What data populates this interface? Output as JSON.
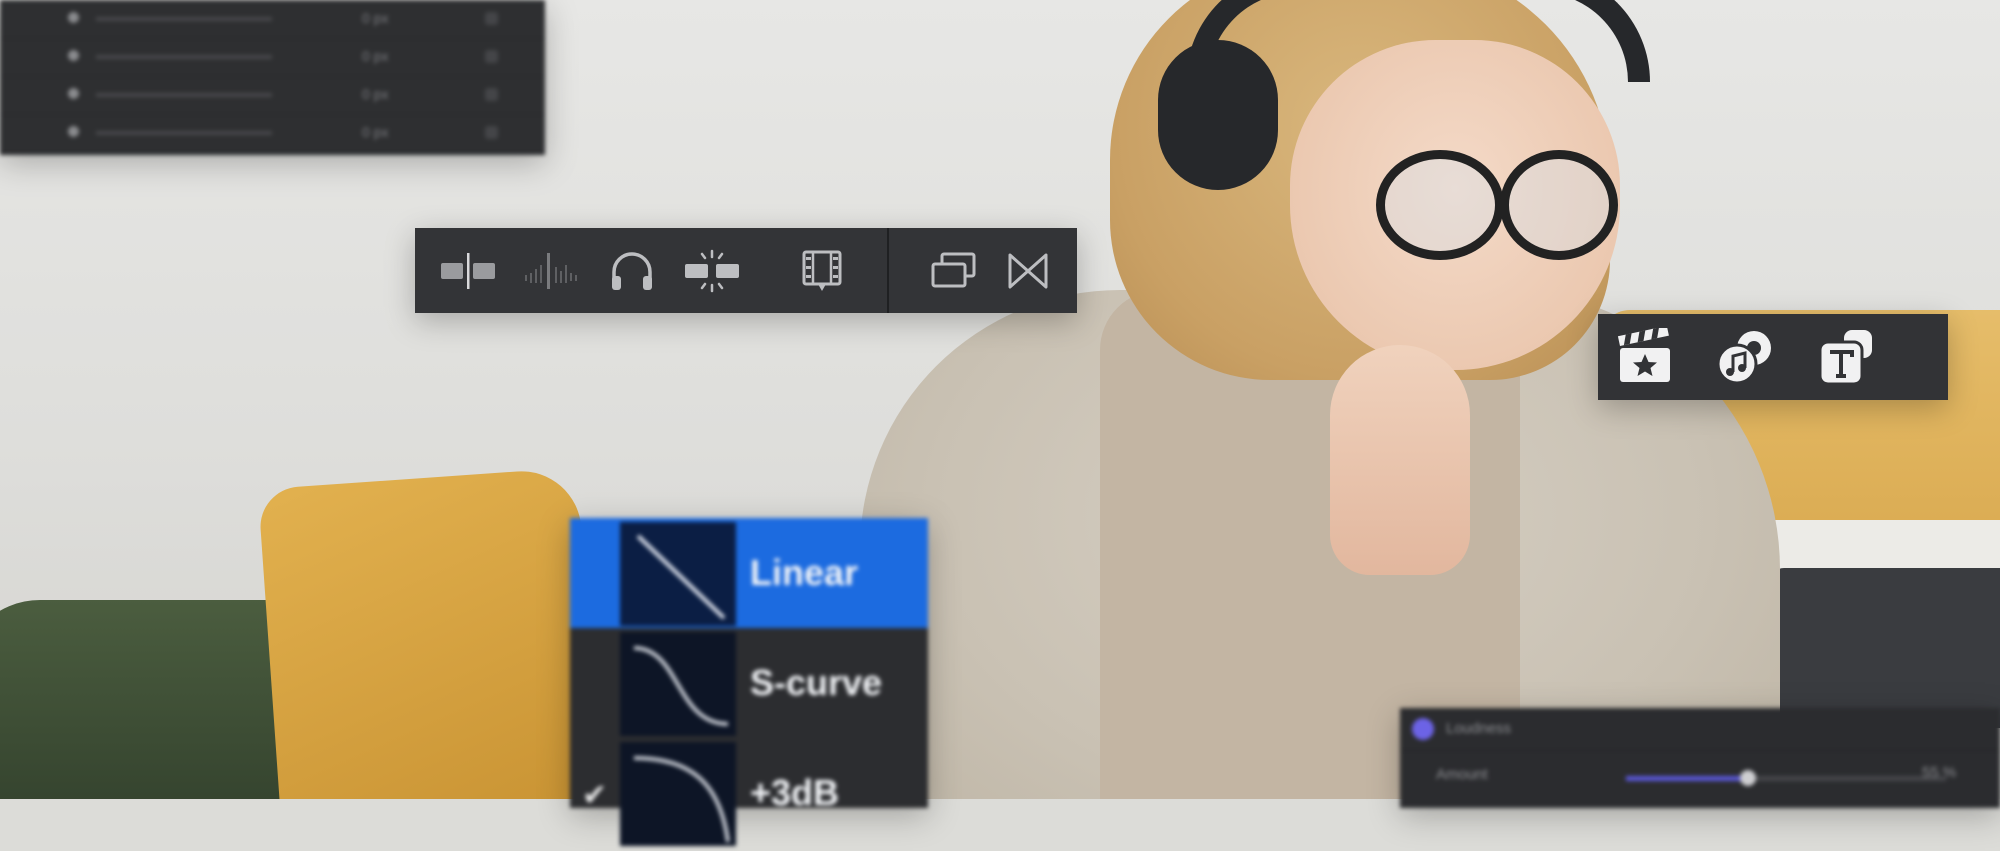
{
  "layer_panel": {
    "rows": [
      {
        "value": "0 px"
      },
      {
        "value": "0 px"
      },
      {
        "value": "0 px"
      },
      {
        "value": "0 px"
      }
    ]
  },
  "edit_toolbar": {
    "buttons": [
      {
        "name": "split-clip-icon"
      },
      {
        "name": "audio-waveform-icon"
      },
      {
        "name": "headphones-icon"
      },
      {
        "name": "ripple-split-icon"
      },
      {
        "name": "film-marker-icon"
      },
      {
        "name": "overlay-clip-icon"
      },
      {
        "name": "transition-bowtie-icon"
      }
    ]
  },
  "media_toolbar": {
    "buttons": [
      {
        "name": "favorite-clapboard-icon"
      },
      {
        "name": "music-photo-icon"
      },
      {
        "name": "titles-icon"
      }
    ]
  },
  "curve_menu": {
    "items": [
      {
        "label": "Linear",
        "selected": true,
        "checked": false
      },
      {
        "label": "S-curve",
        "selected": false,
        "checked": false
      },
      {
        "label": "+3dB",
        "selected": false,
        "checked": true
      }
    ],
    "checkmark": "✔"
  },
  "inspector": {
    "title": "Loudness",
    "amount_label": "Amount",
    "amount_fraction": 0.38,
    "amount_value": "55 %"
  },
  "colors": {
    "accent_blue": "#1c6be0",
    "panel_dark": "#303134",
    "inspector_accent": "#5a57d8"
  }
}
